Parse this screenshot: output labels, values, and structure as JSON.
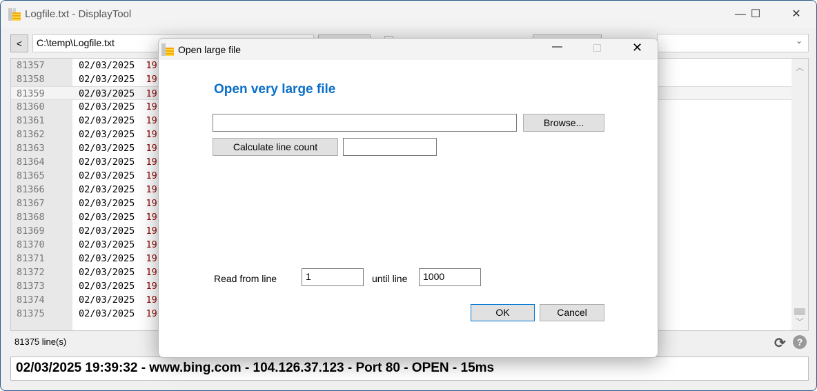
{
  "window": {
    "title": "Logfile.txt - DisplayTool",
    "minimize": "—",
    "maximize": "☐",
    "close": "✕"
  },
  "toolbar": {
    "back_label": "<",
    "path": "C:\\temp\\Logfile.txt",
    "combo_value": ""
  },
  "log": {
    "date": "02/03/2025",
    "hour": "19",
    "lines": [
      "81357",
      "81358",
      "81359",
      "81360",
      "81361",
      "81362",
      "81363",
      "81364",
      "81365",
      "81366",
      "81367",
      "81368",
      "81369",
      "81370",
      "81371",
      "81372",
      "81373",
      "81374",
      "81375"
    ],
    "selected": "81359"
  },
  "status": {
    "line_count": "81375 line(s)",
    "refresh_icon": "refresh-icon",
    "help_icon": "help-icon"
  },
  "detail": {
    "text": "02/03/2025 19:39:32 - www.bing.com - 104.126.37.123 - Port 80 - OPEN - 15ms"
  },
  "dialog": {
    "title": "Open large file",
    "heading": "Open very large file",
    "file_path": "",
    "browse_label": "Browse...",
    "calc_label": "Calculate line count",
    "line_count_value": "",
    "read_from_label": "Read from line",
    "read_from_value": "1",
    "until_label": "until line",
    "until_value": "1000",
    "ok_label": "OK",
    "cancel_label": "Cancel",
    "heading_color": "#0b6fc7"
  }
}
